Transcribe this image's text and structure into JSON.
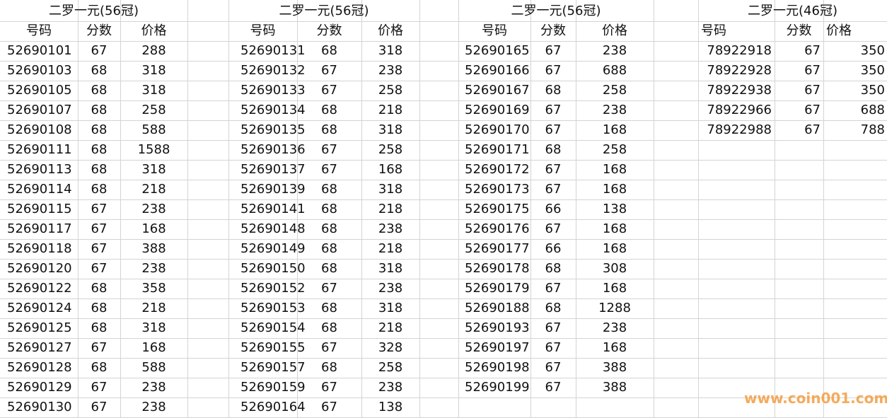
{
  "blocks": [
    {
      "title": "二罗一元(56冠)",
      "headers": [
        "号码",
        "分数",
        "价格"
      ],
      "rows": [
        [
          "52690101",
          "67",
          "288"
        ],
        [
          "52690103",
          "68",
          "318"
        ],
        [
          "52690105",
          "68",
          "318"
        ],
        [
          "52690107",
          "68",
          "258"
        ],
        [
          "52690108",
          "68",
          "588"
        ],
        [
          "52690111",
          "68",
          "1588"
        ],
        [
          "52690113",
          "68",
          "318"
        ],
        [
          "52690114",
          "68",
          "218"
        ],
        [
          "52690115",
          "67",
          "238"
        ],
        [
          "52690117",
          "67",
          "168"
        ],
        [
          "52690118",
          "67",
          "388"
        ],
        [
          "52690120",
          "67",
          "238"
        ],
        [
          "52690122",
          "68",
          "358"
        ],
        [
          "52690124",
          "68",
          "218"
        ],
        [
          "52690125",
          "68",
          "318"
        ],
        [
          "52690127",
          "67",
          "168"
        ],
        [
          "52690128",
          "68",
          "588"
        ],
        [
          "52690129",
          "67",
          "238"
        ],
        [
          "52690130",
          "67",
          "238"
        ]
      ]
    },
    {
      "title": "二罗一元(56冠)",
      "headers": [
        "号码",
        "分数",
        "价格"
      ],
      "rows": [
        [
          "52690131",
          "68",
          "318"
        ],
        [
          "52690132",
          "67",
          "238"
        ],
        [
          "52690133",
          "67",
          "258"
        ],
        [
          "52690134",
          "68",
          "218"
        ],
        [
          "52690135",
          "68",
          "318"
        ],
        [
          "52690136",
          "67",
          "258"
        ],
        [
          "52690137",
          "67",
          "168"
        ],
        [
          "52690139",
          "68",
          "318"
        ],
        [
          "52690141",
          "68",
          "218"
        ],
        [
          "52690148",
          "68",
          "238"
        ],
        [
          "52690149",
          "68",
          "218"
        ],
        [
          "52690150",
          "68",
          "318"
        ],
        [
          "52690152",
          "67",
          "238"
        ],
        [
          "52690153",
          "68",
          "318"
        ],
        [
          "52690154",
          "68",
          "218"
        ],
        [
          "52690155",
          "67",
          "328"
        ],
        [
          "52690157",
          "68",
          "258"
        ],
        [
          "52690159",
          "67",
          "238"
        ],
        [
          "52690164",
          "67",
          "138"
        ]
      ]
    },
    {
      "title": "二罗一元(56冠)",
      "headers": [
        "号码",
        "分数",
        "价格"
      ],
      "rows": [
        [
          "52690165",
          "67",
          "238"
        ],
        [
          "52690166",
          "67",
          "688"
        ],
        [
          "52690167",
          "68",
          "258"
        ],
        [
          "52690169",
          "67",
          "238"
        ],
        [
          "52690170",
          "67",
          "168"
        ],
        [
          "52690171",
          "68",
          "258"
        ],
        [
          "52690172",
          "67",
          "168"
        ],
        [
          "52690173",
          "67",
          "168"
        ],
        [
          "52690175",
          "66",
          "138"
        ],
        [
          "52690176",
          "67",
          "168"
        ],
        [
          "52690177",
          "66",
          "168"
        ],
        [
          "52690178",
          "68",
          "308"
        ],
        [
          "52690179",
          "67",
          "168"
        ],
        [
          "52690188",
          "68",
          "1288"
        ],
        [
          "52690193",
          "67",
          "238"
        ],
        [
          "52690197",
          "67",
          "168"
        ],
        [
          "52690198",
          "67",
          "388"
        ],
        [
          "52690199",
          "67",
          "388"
        ]
      ]
    },
    {
      "title": "二罗一元(46冠)",
      "headers": [
        "号码",
        "分数",
        "价格"
      ],
      "rows": [
        [
          "78922918",
          "67",
          "350"
        ],
        [
          "78922928",
          "67",
          "350"
        ],
        [
          "78922938",
          "67",
          "350"
        ],
        [
          "78922966",
          "67",
          "688"
        ],
        [
          "78922988",
          "67",
          "788"
        ]
      ]
    }
  ],
  "watermark": "www.coin001.com"
}
